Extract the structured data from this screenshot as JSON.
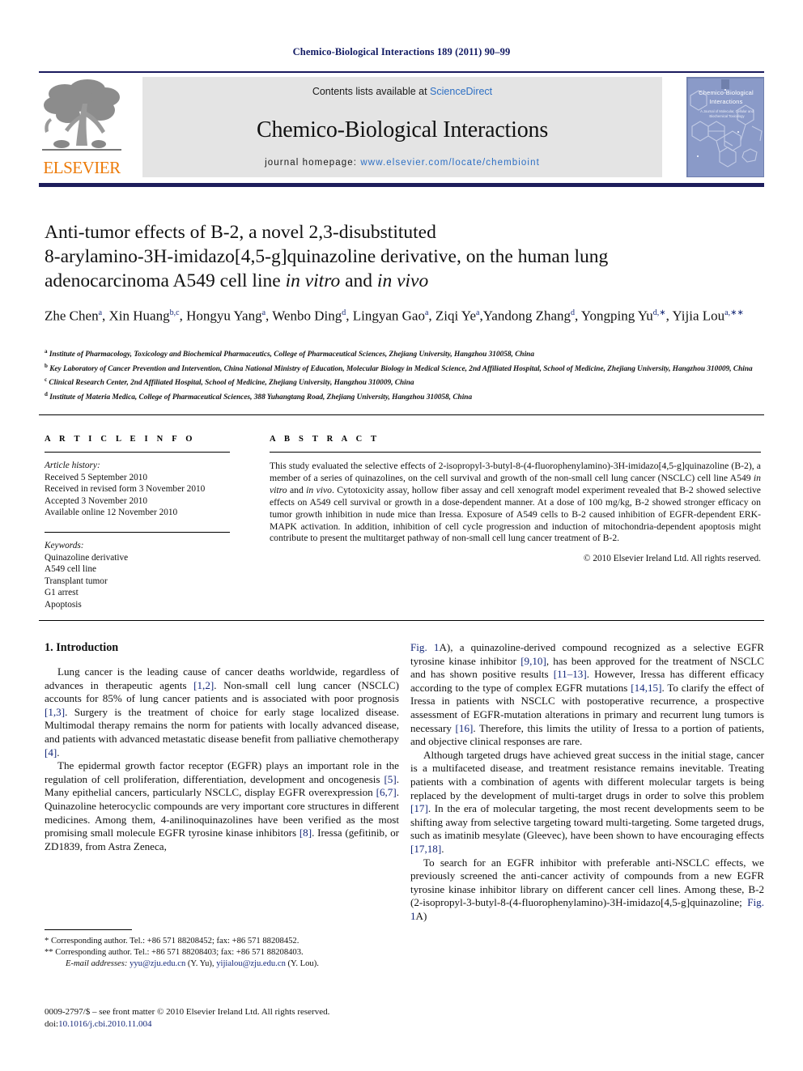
{
  "running_head": "Chemico-Biological Interactions 189 (2011) 90–99",
  "masthead": {
    "publisher_logo_word": "ELSEVIER",
    "contents_prefix": "Contents lists available at ",
    "contents_link": "ScienceDirect",
    "journal_name": "Chemico-Biological Interactions",
    "homepage_label": "journal homepage:",
    "homepage_url": "www.elsevier.com/locate/chembioint",
    "cover_title": "Chemico-Biological Interactions",
    "cover_subtitle": "A Journal of Molecular, Cellular and Biochemical Toxicology",
    "link_color": "#2d6fc4",
    "rule_color": "#1a1a5e",
    "banner_bg": "#e4e4e4"
  },
  "article": {
    "title_line1": "Anti-tumor effects of B-2, a novel 2,3-disubstituted",
    "title_line2": "8-arylamino-3H-imidazo[4,5-g]quinazoline derivative, on the human lung",
    "title_line3_a": "adenocarcinoma A549 cell line ",
    "title_line3_ital1": "in vitro",
    "title_line3_b": " and ",
    "title_line3_ital2": "in vivo",
    "authors": [
      {
        "name": "Zhe Chen",
        "sup": "a",
        "sep": ", "
      },
      {
        "name": "Xin Huang",
        "sup": "b,c",
        "sep": ", "
      },
      {
        "name": "Hongyu Yang",
        "sup": "a",
        "sep": ", "
      },
      {
        "name": "Wenbo Ding",
        "sup": "d",
        "sep": ", "
      },
      {
        "name": "Lingyan Gao",
        "sup": "a",
        "sep": ", "
      },
      {
        "name": "Ziqi Ye",
        "sup": "a",
        "sep": ","
      },
      {
        "name": "Yandong Zhang",
        "sup": "d",
        "sep": ", "
      },
      {
        "name": "Yongping Yu",
        "sup": "d,∗",
        "sep": ", "
      },
      {
        "name": "Yijia Lou",
        "sup": "a,∗∗",
        "sep": ""
      }
    ],
    "affiliations": [
      {
        "mark": "a",
        "text": "Institute of Pharmacology, Toxicology and Biochemical Pharmaceutics, College of Pharmaceutical Sciences, Zhejiang University, Hangzhou 310058, China"
      },
      {
        "mark": "b",
        "text": "Key Laboratory of Cancer Prevention and Intervention, China National Ministry of Education, Molecular Biology in Medical Science, 2nd Affiliated Hospital, School of Medicine, Zhejiang University, Hangzhou 310009, China"
      },
      {
        "mark": "c",
        "text": "Clinical Research Center, 2nd Affiliated Hospital, School of Medicine, Zhejiang University, Hangzhou 310009, China"
      },
      {
        "mark": "d",
        "text": "Institute of Materia Medica, College of Pharmaceutical Sciences, 388 Yuhangtang Road, Zhejiang University, Hangzhou 310058, China"
      }
    ]
  },
  "article_info": {
    "heading": "A R T I C L E   I N F O",
    "history_label": "Article history:",
    "history": [
      "Received 5 September 2010",
      "Received in revised form 3 November 2010",
      "Accepted 3 November 2010",
      "Available online 12 November 2010"
    ],
    "keywords_label": "Keywords:",
    "keywords": [
      "Quinazoline derivative",
      "A549 cell line",
      "Transplant tumor",
      "G1 arrest",
      "Apoptosis"
    ]
  },
  "abstract": {
    "heading": "A B S T R A C T",
    "seg1": "This study evaluated the selective effects of 2-isopropyl-3-butyl-8-(4-fluorophenylamino)-3H-imidazo[4,5-g]quinazoline (B-2), a member of a series of quinazolines, on the cell survival and growth of the non-small cell lung cancer (NSCLC) cell line A549 ",
    "ital1": "in vitro",
    "seg2": " and ",
    "ital2": "in vivo",
    "seg3": ". Cytotoxicity assay, hollow fiber assay and cell xenograft model experiment revealed that B-2 showed selective effects on A549 cell survival or growth in a dose-dependent manner. At a dose of 100 mg/kg, B-2 showed stronger efficacy on tumor growth inhibition in nude mice than Iressa. Exposure of A549 cells to B-2 caused inhibition of EGFR-dependent ERK-MAPK activation. In addition, inhibition of cell cycle progression and induction of mitochondria-dependent apoptosis might contribute to present the multitarget pathway of non-small cell lung cancer treatment of B-2.",
    "copyright": "© 2010 Elsevier Ireland Ltd. All rights reserved."
  },
  "introduction": {
    "heading": "1.  Introduction",
    "left_p1_a": "Lung cancer is the leading cause of cancer deaths worldwide, regardless of advances in therapeutic agents ",
    "left_p1_r1": "[1,2]",
    "left_p1_b": ". Non-small cell lung cancer (NSCLC) accounts for 85% of lung cancer patients and is associated with poor prognosis ",
    "left_p1_r2": "[1,3]",
    "left_p1_c": ". Surgery is the treatment of choice for early stage localized disease. Multimodal therapy remains the norm for patients with locally advanced disease, and patients with advanced metastatic disease benefit from palliative chemotherapy ",
    "left_p1_r3": "[4]",
    "left_p1_d": ".",
    "left_p2_a": "The epidermal growth factor receptor (EGFR) plays an important role in the regulation of cell proliferation, differentiation, development and oncogenesis ",
    "left_p2_r1": "[5]",
    "left_p2_b": ". Many epithelial cancers, particularly NSCLC, display EGFR overexpression ",
    "left_p2_r2": "[6,7]",
    "left_p2_c": ". Quinazoline heterocyclic compounds are very important core structures in different medicines. Among them, 4-anilinoquinazolines have been verified as the most promising small molecule EGFR tyrosine kinase inhibitors ",
    "left_p2_r3": "[8]",
    "left_p2_d": ". Iressa (gefitinib, or ZD1839, from Astra Zeneca,",
    "right_p1_r0": "Fig. 1",
    "right_p1_a": "A), a quinazoline-derived compound recognized as a selective EGFR tyrosine kinase inhibitor ",
    "right_p1_r1": "[9,10]",
    "right_p1_b": ", has been approved for the treatment of NSCLC and has shown positive results ",
    "right_p1_r2": "[11–13]",
    "right_p1_c": ". However, Iressa has different efficacy according to the type of complex EGFR mutations ",
    "right_p1_r3": "[14,15]",
    "right_p1_d": ". To clarify the effect of Iressa in patients with NSCLC with postoperative recurrence, a prospective assessment of EGFR-mutation alterations in primary and recurrent lung tumors is necessary ",
    "right_p1_r4": "[16]",
    "right_p1_e": ". Therefore, this limits the utility of Iressa to a portion of patients, and objective clinical responses are rare.",
    "right_p2_a": "Although targeted drugs have achieved great success in the initial stage, cancer is a multifaceted disease, and treatment resistance remains inevitable. Treating patients with a combination of agents with different molecular targets is being replaced by the development of multi-target drugs in order to solve this problem ",
    "right_p2_r1": "[17]",
    "right_p2_b": ". In the era of molecular targeting, the most recent developments seem to be shifting away from selective targeting toward multi-targeting. Some targeted drugs, such as imatinib mesylate (Gleevec), have been shown to have encouraging effects ",
    "right_p2_r2": "[17,18]",
    "right_p2_c": ".",
    "right_p3_a": "To search for an EGFR inhibitor with preferable anti-NSCLC effects, we previously screened the anti-cancer activity of compounds from a new EGFR tyrosine kinase inhibitor library on different cancer cell lines. Among these, B-2 (2-isopropyl-3-butyl-8-(4-fluorophenylamino)-3H-imidazo[4,5-g]quinazoline; ",
    "right_p3_r1": "Fig. 1",
    "right_p3_b": "A)"
  },
  "footnotes": {
    "fn1": "* Corresponding author. Tel.: +86 571 88208452; fax: +86 571 88208452.",
    "fn2": "** Corresponding author. Tel.: +86 571 88208403; fax: +86 571 88208403.",
    "fn3_label": "E-mail addresses:",
    "fn3_mail1": "yyu@zju.edu.cn",
    "fn3_name1": " (Y. Yu), ",
    "fn3_mail2": "yijialou@zju.edu.cn",
    "fn3_name2": " (Y. Lou).",
    "imprint_line1": "0009-2797/$ – see front matter © 2010 Elsevier Ireland Ltd. All rights reserved.",
    "imprint_doi_label": "doi:",
    "imprint_doi": "10.1016/j.cbi.2010.11.004"
  }
}
